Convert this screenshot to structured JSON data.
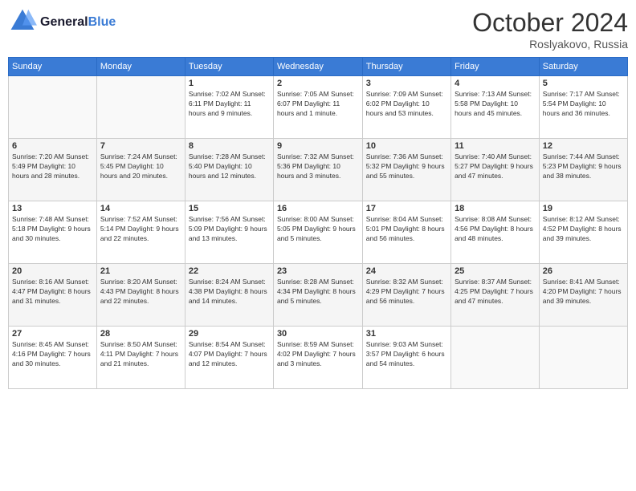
{
  "logo": {
    "line1": "General",
    "line2": "Blue"
  },
  "title": "October 2024",
  "location": "Roslyakovo, Russia",
  "days_of_week": [
    "Sunday",
    "Monday",
    "Tuesday",
    "Wednesday",
    "Thursday",
    "Friday",
    "Saturday"
  ],
  "weeks": [
    [
      {
        "day": "",
        "info": ""
      },
      {
        "day": "",
        "info": ""
      },
      {
        "day": "1",
        "info": "Sunrise: 7:02 AM\nSunset: 6:11 PM\nDaylight: 11 hours\nand 9 minutes."
      },
      {
        "day": "2",
        "info": "Sunrise: 7:05 AM\nSunset: 6:07 PM\nDaylight: 11 hours\nand 1 minute."
      },
      {
        "day": "3",
        "info": "Sunrise: 7:09 AM\nSunset: 6:02 PM\nDaylight: 10 hours\nand 53 minutes."
      },
      {
        "day": "4",
        "info": "Sunrise: 7:13 AM\nSunset: 5:58 PM\nDaylight: 10 hours\nand 45 minutes."
      },
      {
        "day": "5",
        "info": "Sunrise: 7:17 AM\nSunset: 5:54 PM\nDaylight: 10 hours\nand 36 minutes."
      }
    ],
    [
      {
        "day": "6",
        "info": "Sunrise: 7:20 AM\nSunset: 5:49 PM\nDaylight: 10 hours\nand 28 minutes."
      },
      {
        "day": "7",
        "info": "Sunrise: 7:24 AM\nSunset: 5:45 PM\nDaylight: 10 hours\nand 20 minutes."
      },
      {
        "day": "8",
        "info": "Sunrise: 7:28 AM\nSunset: 5:40 PM\nDaylight: 10 hours\nand 12 minutes."
      },
      {
        "day": "9",
        "info": "Sunrise: 7:32 AM\nSunset: 5:36 PM\nDaylight: 10 hours\nand 3 minutes."
      },
      {
        "day": "10",
        "info": "Sunrise: 7:36 AM\nSunset: 5:32 PM\nDaylight: 9 hours\nand 55 minutes."
      },
      {
        "day": "11",
        "info": "Sunrise: 7:40 AM\nSunset: 5:27 PM\nDaylight: 9 hours\nand 47 minutes."
      },
      {
        "day": "12",
        "info": "Sunrise: 7:44 AM\nSunset: 5:23 PM\nDaylight: 9 hours\nand 38 minutes."
      }
    ],
    [
      {
        "day": "13",
        "info": "Sunrise: 7:48 AM\nSunset: 5:18 PM\nDaylight: 9 hours\nand 30 minutes."
      },
      {
        "day": "14",
        "info": "Sunrise: 7:52 AM\nSunset: 5:14 PM\nDaylight: 9 hours\nand 22 minutes."
      },
      {
        "day": "15",
        "info": "Sunrise: 7:56 AM\nSunset: 5:09 PM\nDaylight: 9 hours\nand 13 minutes."
      },
      {
        "day": "16",
        "info": "Sunrise: 8:00 AM\nSunset: 5:05 PM\nDaylight: 9 hours\nand 5 minutes."
      },
      {
        "day": "17",
        "info": "Sunrise: 8:04 AM\nSunset: 5:01 PM\nDaylight: 8 hours\nand 56 minutes."
      },
      {
        "day": "18",
        "info": "Sunrise: 8:08 AM\nSunset: 4:56 PM\nDaylight: 8 hours\nand 48 minutes."
      },
      {
        "day": "19",
        "info": "Sunrise: 8:12 AM\nSunset: 4:52 PM\nDaylight: 8 hours\nand 39 minutes."
      }
    ],
    [
      {
        "day": "20",
        "info": "Sunrise: 8:16 AM\nSunset: 4:47 PM\nDaylight: 8 hours\nand 31 minutes."
      },
      {
        "day": "21",
        "info": "Sunrise: 8:20 AM\nSunset: 4:43 PM\nDaylight: 8 hours\nand 22 minutes."
      },
      {
        "day": "22",
        "info": "Sunrise: 8:24 AM\nSunset: 4:38 PM\nDaylight: 8 hours\nand 14 minutes."
      },
      {
        "day": "23",
        "info": "Sunrise: 8:28 AM\nSunset: 4:34 PM\nDaylight: 8 hours\nand 5 minutes."
      },
      {
        "day": "24",
        "info": "Sunrise: 8:32 AM\nSunset: 4:29 PM\nDaylight: 7 hours\nand 56 minutes."
      },
      {
        "day": "25",
        "info": "Sunrise: 8:37 AM\nSunset: 4:25 PM\nDaylight: 7 hours\nand 47 minutes."
      },
      {
        "day": "26",
        "info": "Sunrise: 8:41 AM\nSunset: 4:20 PM\nDaylight: 7 hours\nand 39 minutes."
      }
    ],
    [
      {
        "day": "27",
        "info": "Sunrise: 8:45 AM\nSunset: 4:16 PM\nDaylight: 7 hours\nand 30 minutes."
      },
      {
        "day": "28",
        "info": "Sunrise: 8:50 AM\nSunset: 4:11 PM\nDaylight: 7 hours\nand 21 minutes."
      },
      {
        "day": "29",
        "info": "Sunrise: 8:54 AM\nSunset: 4:07 PM\nDaylight: 7 hours\nand 12 minutes."
      },
      {
        "day": "30",
        "info": "Sunrise: 8:59 AM\nSunset: 4:02 PM\nDaylight: 7 hours\nand 3 minutes."
      },
      {
        "day": "31",
        "info": "Sunrise: 9:03 AM\nSunset: 3:57 PM\nDaylight: 6 hours\nand 54 minutes."
      },
      {
        "day": "",
        "info": ""
      },
      {
        "day": "",
        "info": ""
      }
    ]
  ]
}
